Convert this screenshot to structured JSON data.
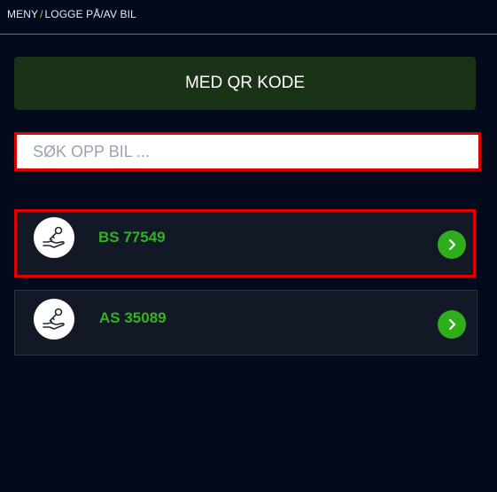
{
  "breadcrumb": {
    "menu": "MENY",
    "separator": "/",
    "current": "LOGGE PÅ/AV BIL"
  },
  "qr_button": {
    "label": "MED QR KODE"
  },
  "search": {
    "placeholder": "SØK OPP BIL ...",
    "value": ""
  },
  "cars": [
    {
      "plate": "BS 77549",
      "icon": "hand-key-icon",
      "selected": true
    },
    {
      "plate": "AS 35089",
      "icon": "hand-key-icon",
      "selected": false
    }
  ],
  "colors": {
    "background": "#030a1c",
    "qr_button_bg": "#1a3216",
    "accent_green": "#2fae1c",
    "plate_text": "#33b31f",
    "highlight_border": "#e00000"
  }
}
